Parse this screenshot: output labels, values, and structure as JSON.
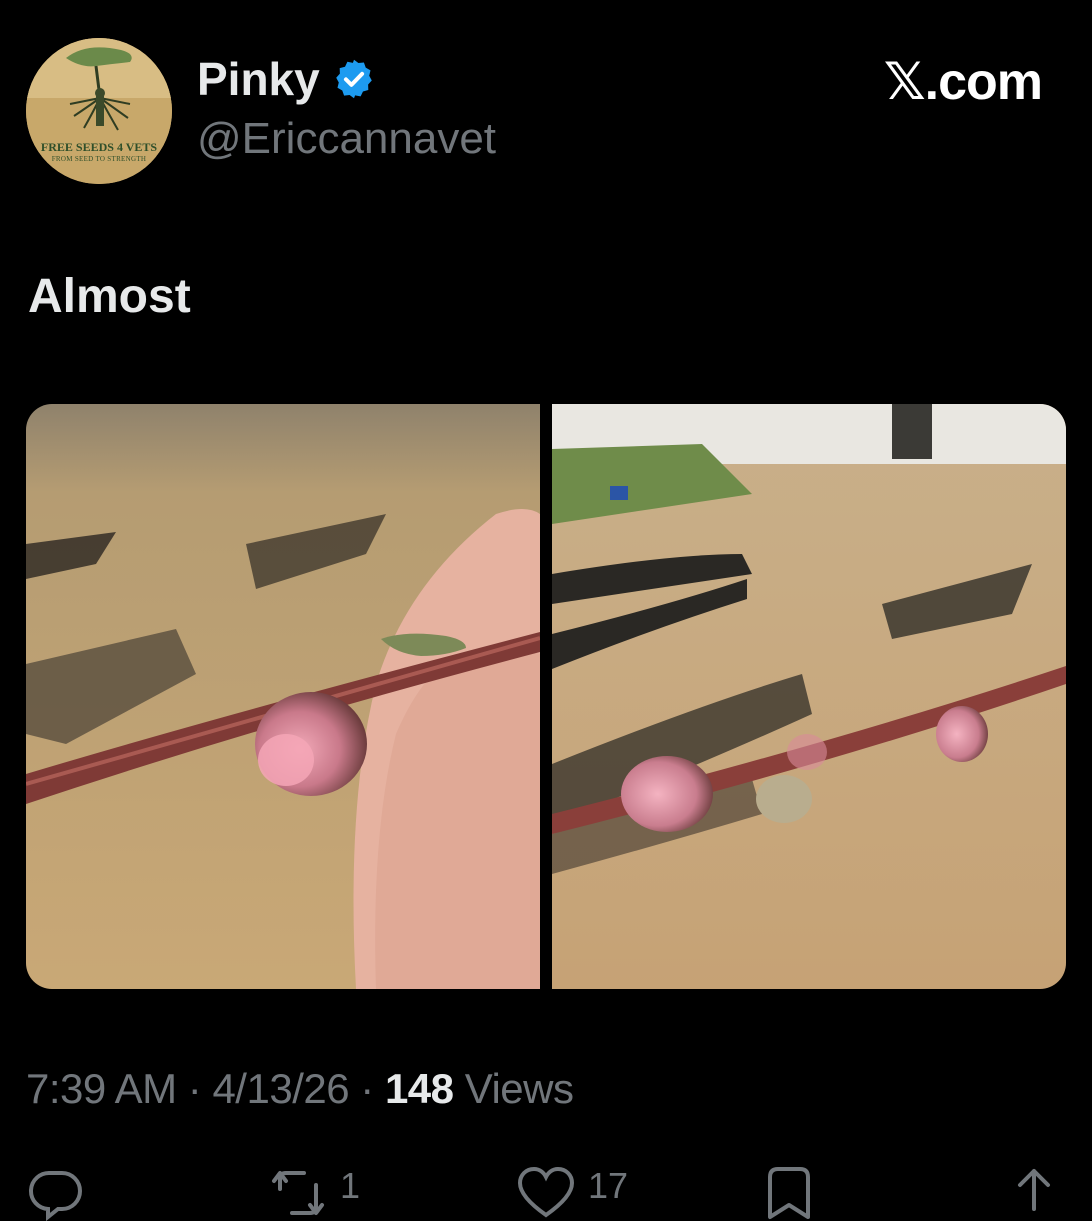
{
  "author": {
    "display_name": "Pinky",
    "handle": "@Ericcannavet",
    "verified": true,
    "verified_color": "#1d9bf0",
    "avatar": {
      "icon": "tree-roots-soldier-logo",
      "line1": "FREE SEEDS 4 VETS",
      "line2": "FROM SEED TO STRENGTH"
    }
  },
  "brand": "𝕏.com",
  "tweet": {
    "text": "Almost",
    "images": [
      {
        "name": "pink-bud-on-branch-closeup"
      },
      {
        "name": "pink-buds-orchard-view"
      }
    ]
  },
  "meta": {
    "time": "7:39 AM",
    "separator": "·",
    "date": "4/13/26",
    "views_count": "148",
    "views_label": "Views"
  },
  "actions": {
    "reply": {
      "icon": "reply-icon",
      "count": ""
    },
    "repost": {
      "icon": "repost-icon",
      "count": "1"
    },
    "like": {
      "icon": "heart-icon",
      "count": "17"
    },
    "bookmark": {
      "icon": "bookmark-icon",
      "count": ""
    },
    "share": {
      "icon": "share-icon",
      "count": ""
    }
  },
  "colors": {
    "background": "#000000",
    "text_primary": "#e7e9ea",
    "text_secondary": "#71767b"
  }
}
